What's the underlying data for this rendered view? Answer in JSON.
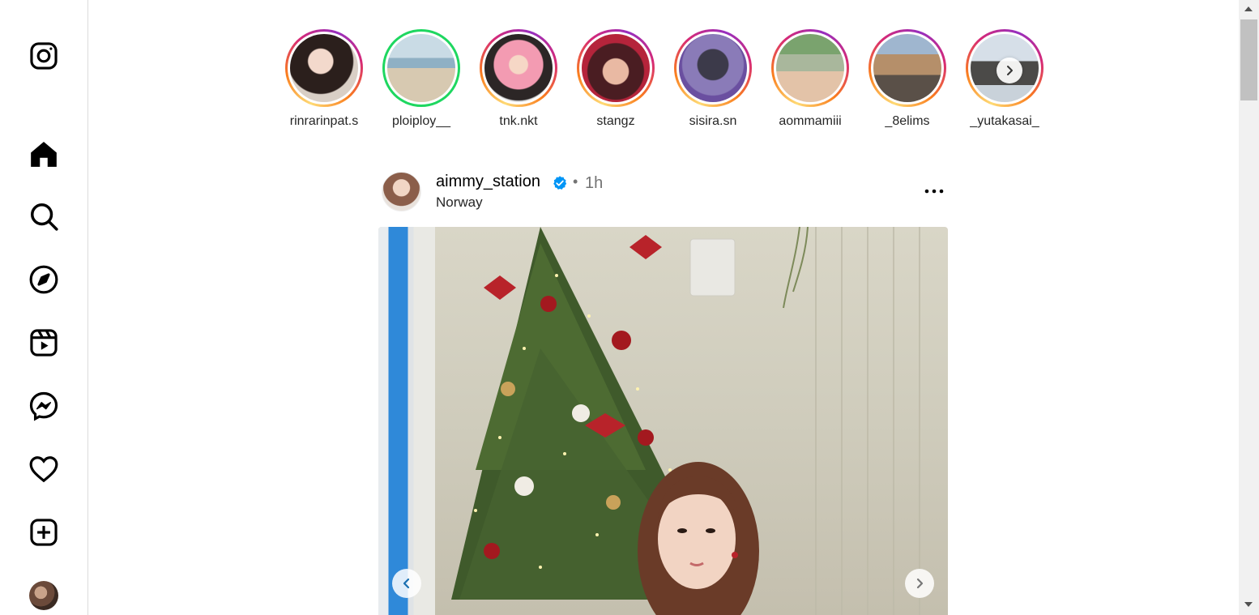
{
  "sidebar": {
    "items": [
      {
        "name": "instagram-logo-icon"
      },
      {
        "name": "home-icon"
      },
      {
        "name": "search-icon"
      },
      {
        "name": "explore-icon"
      },
      {
        "name": "reels-icon"
      },
      {
        "name": "messenger-icon"
      },
      {
        "name": "notifications-heart-icon"
      },
      {
        "name": "create-plus-icon"
      },
      {
        "name": "profile-avatar"
      }
    ]
  },
  "stories": [
    {
      "username": "rinrarinpat.s",
      "ring": "gradient"
    },
    {
      "username": "ploiploy__",
      "ring": "close-friends"
    },
    {
      "username": "tnk.nkt",
      "ring": "gradient"
    },
    {
      "username": "stangz",
      "ring": "gradient"
    },
    {
      "username": "sisira.sn",
      "ring": "gradient"
    },
    {
      "username": "aommamiii",
      "ring": "gradient"
    },
    {
      "username": "_8elims",
      "ring": "gradient"
    },
    {
      "username": "_yutakasai_",
      "ring": "gradient"
    }
  ],
  "post": {
    "username": "aimmy_station",
    "separator": "•",
    "time": "1h",
    "location": "Norway",
    "verified": true
  },
  "colors": {
    "verified_blue": "#0095f6",
    "close_friends_green": "#1ed760",
    "secondary_text": "#737373",
    "border": "#dbdbdb"
  }
}
